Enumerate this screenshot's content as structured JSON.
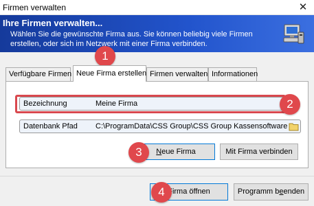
{
  "window": {
    "title": "Firmen verwalten",
    "close_glyph": "✕"
  },
  "banner": {
    "title": "Ihre Firmen verwalten...",
    "text": "Wählen Sie die gewünschte Firma aus. Sie können beliebig viele Firmen erstellen, oder sich im Netzwerk mit einer Firma verbinden.",
    "icon": "computer-icon",
    "color": "#2254cc"
  },
  "tabs": [
    {
      "label": "Verfügbare Firmen"
    },
    {
      "label": "Neue Firma erstellen",
      "active": true
    },
    {
      "label": "Firmen verwalten"
    },
    {
      "label": "Informationen"
    }
  ],
  "form": {
    "name_label": "Bezeichnung",
    "name_value": "Meine Firma",
    "db_label": "Datenbank Pfad",
    "db_value": "C:\\ProgramData\\CSS Group\\CSS Group Kassensoftware"
  },
  "buttons": {
    "new_first": "N",
    "new_rest": "eue Firma",
    "connect": "Mit Firma verbinden",
    "open": "Firma öffnen",
    "quit_a": "Programm b",
    "quit_u": "e",
    "quit_b": "enden"
  },
  "callouts": [
    "1",
    "2",
    "3",
    "4"
  ],
  "colors": {
    "callout": "#e0484c",
    "focus": "#0078d7"
  }
}
